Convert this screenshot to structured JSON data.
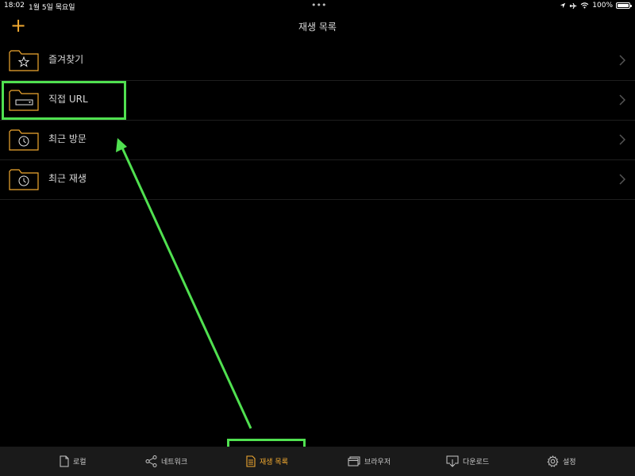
{
  "status_bar": {
    "time": "18:02",
    "date": "1월 5일 목요일",
    "dots": "•••",
    "battery_text": "100%"
  },
  "nav": {
    "add_label": "+",
    "title": "재생 목록"
  },
  "list": [
    {
      "label": "즐겨찾기",
      "icon": "star-folder-icon"
    },
    {
      "label": "직접 URL",
      "icon": "url-folder-icon"
    },
    {
      "label": "최근 방문",
      "icon": "clock-folder-icon"
    },
    {
      "label": "최근 재생",
      "icon": "clock-folder-icon"
    }
  ],
  "tabs": [
    {
      "label": "로컬",
      "icon": "document-icon",
      "active": false
    },
    {
      "label": "네트워크",
      "icon": "share-icon",
      "active": false
    },
    {
      "label": "재생 목록",
      "icon": "playlist-icon",
      "active": true
    },
    {
      "label": "브라우저",
      "icon": "browser-icon",
      "active": false
    },
    {
      "label": "다운로드",
      "icon": "download-icon",
      "active": false
    },
    {
      "label": "설정",
      "icon": "gear-icon",
      "active": false
    }
  ],
  "colors": {
    "accent": "#f0a830",
    "highlight": "#50e050",
    "background": "#000000",
    "tab_bar": "#1a1a1a"
  }
}
